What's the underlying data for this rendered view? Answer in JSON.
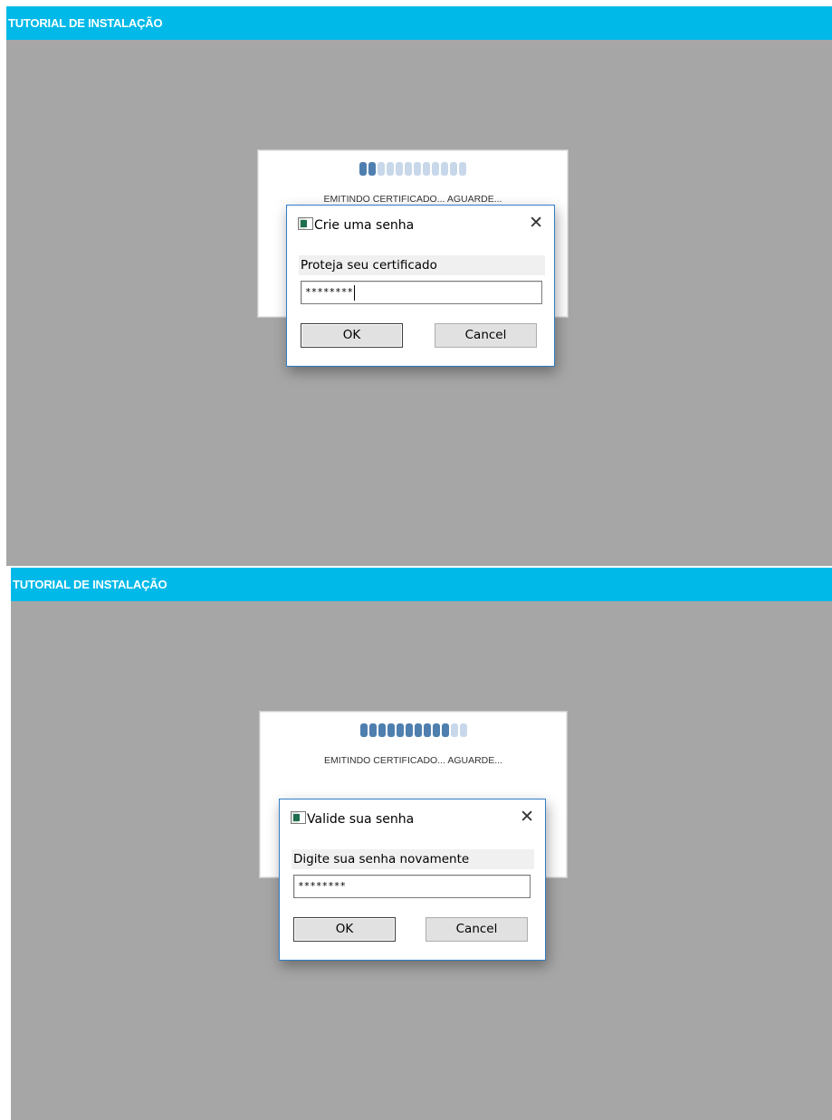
{
  "panels": [
    {
      "banner_title": "TUTORIAL DE INSTALAÇÃO",
      "progress": {
        "filled_segments": 2,
        "total_segments": 12,
        "status_text": "EMITINDO CERTIFICADO... AGUARDE..."
      },
      "dialog": {
        "title": "Crie uma senha",
        "prompt": "Proteja seu certificado",
        "password_value": "********",
        "ok_label": "OK",
        "cancel_label": "Cancel",
        "close_glyph": "✕"
      }
    },
    {
      "banner_title": "TUTORIAL DE INSTALAÇÃO",
      "progress": {
        "filled_segments": 10,
        "total_segments": 12,
        "status_text": "EMITINDO CERTIFICADO... AGUARDE..."
      },
      "dialog": {
        "title": "Valide sua senha",
        "prompt": "Digite sua senha novamente",
        "password_value": "********",
        "ok_label": "OK",
        "cancel_label": "Cancel",
        "close_glyph": "✕"
      }
    }
  ],
  "colors": {
    "banner": "#00b9e8",
    "stage": "#a6a6a6",
    "progress_on": "#4e7fae",
    "progress_off": "#c8d8ea",
    "dialog_border": "#2f7ec7"
  },
  "icons": {
    "app_icon": "window-app-icon",
    "close": "close-icon"
  }
}
